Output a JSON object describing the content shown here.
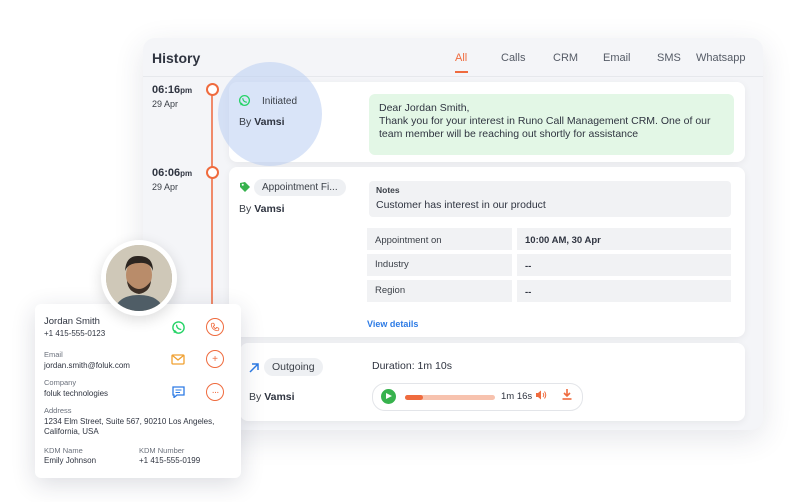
{
  "history": {
    "title": "History",
    "tabs": [
      {
        "label": "All",
        "active": true
      },
      {
        "label": "Calls",
        "active": false
      },
      {
        "label": "CRM",
        "active": false
      },
      {
        "label": "Email",
        "active": false
      },
      {
        "label": "SMS",
        "active": false
      },
      {
        "label": "Whatsapp",
        "active": false
      }
    ]
  },
  "timeline": [
    {
      "time": "06:16",
      "ampm": "pm",
      "date": "29 Apr"
    },
    {
      "time": "06:06",
      "ampm": "pm",
      "date": "29 Apr"
    }
  ],
  "entries": {
    "whatsapp": {
      "chip": "Initiated",
      "by_prefix": "By",
      "by_name": "Vamsi",
      "message": "Dear Jordan Smith,\nThank you for your interest in Runo Call Management CRM. One of our team member will be reaching out shortly for assistance"
    },
    "appointment": {
      "chip": "Appointment Fi...",
      "by_prefix": "By",
      "by_name": "Vamsi",
      "notes_label": "Notes",
      "notes_value": "Customer has interest in our product",
      "rows": [
        {
          "label": "Appointment on",
          "value": "10:00 AM, 30 Apr"
        },
        {
          "label": "Industry",
          "value": "--"
        },
        {
          "label": "Region",
          "value": "--"
        }
      ],
      "view_details": "View details"
    },
    "call": {
      "chip": "Outgoing",
      "by_prefix": "By",
      "by_name": "Vamsi",
      "duration": "Duration: 1m 10s",
      "player_time": "1m 16s",
      "progress": 0.2
    }
  },
  "contact": {
    "name": "Jordan Smith",
    "phone": "+1 415-555-0123",
    "email_label": "Email",
    "email": "jordan.smith@foluk.com",
    "company_label": "Company",
    "company": "foluk technologies",
    "address_label": "Address",
    "address": "1234 Elm Street, Suite 567, 90210 Los Angeles, California, USA",
    "kdm_name_label": "KDM Name",
    "kdm_name": "Emily Johnson",
    "kdm_number_label": "KDM Number",
    "kdm_number": "+1 415-555-0199"
  },
  "colors": {
    "accent": "#ef6b3e",
    "whatsapp": "#25d366",
    "link": "#2d7be5",
    "message_bg": "#e3f7e6"
  },
  "icons": [
    "whatsapp-icon",
    "tag-icon",
    "outgoing-arrow-icon",
    "play-icon",
    "volume-icon",
    "download-icon",
    "phone-icon",
    "mail-icon",
    "plus-icon",
    "chat-icon",
    "more-icon"
  ]
}
